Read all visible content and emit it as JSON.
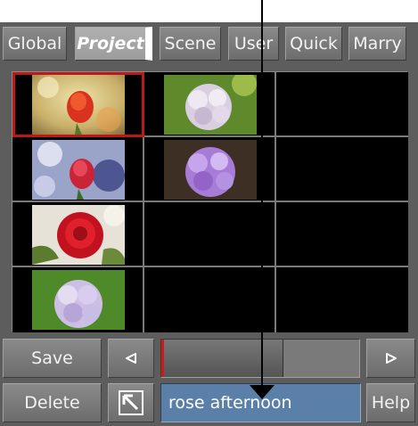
{
  "tabs": [
    {
      "label": "Global",
      "active": false
    },
    {
      "label": "Project",
      "active": true
    },
    {
      "label": "Scene",
      "active": false
    },
    {
      "label": "User",
      "active": false
    },
    {
      "label": "Quick",
      "active": false
    },
    {
      "label": "Marry",
      "active": false
    }
  ],
  "thumbnails": [
    {
      "name": "thumbnail-red-rose-bokeh",
      "selected": true
    },
    {
      "name": "thumbnail-white-hydrangea",
      "selected": false
    },
    {
      "name": "thumbnail-red-rose-blue-bokeh",
      "selected": false
    },
    {
      "name": "thumbnail-purple-hydrangea",
      "selected": false
    },
    {
      "name": "thumbnail-red-rose-closeup",
      "selected": false
    },
    {
      "name": "thumbnail-lilac-hydrangea",
      "selected": false
    }
  ],
  "controls": {
    "save_label": "Save",
    "delete_label": "Delete",
    "help_label": "Help",
    "prev_icon": "left-arrow-icon",
    "next_icon": "right-arrow-icon",
    "import_icon": "arrow-up-left-icon",
    "name_value": "rose afternoon"
  },
  "slider": {
    "position": 0.6
  },
  "colors": {
    "selection": "#c01818",
    "name_field": "#5a7fa8"
  }
}
